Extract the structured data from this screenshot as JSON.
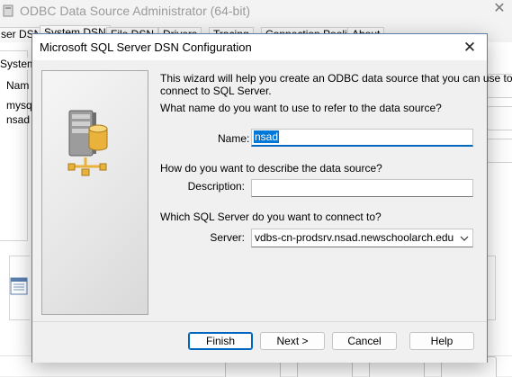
{
  "background_window": {
    "title": "ODBC Data Source Administrator (64-bit)",
    "close_glyph": "✕",
    "tabs": [
      "ser DSN",
      "System DSN",
      "File DSN",
      "Drivers",
      "Tracing",
      "Connection Pooling",
      "About"
    ],
    "group_label": "System",
    "column_header": "Nam",
    "rows": [
      "mysql",
      "nsad"
    ]
  },
  "dialog": {
    "title": "Microsoft SQL Server DSN Configuration",
    "close_glyph": "✕",
    "intro_line1": "This wizard will help you create an ODBC data source that you can use to",
    "intro_line2": "connect to SQL Server.",
    "name_question": "What name do you want to use to refer to the data source?",
    "name_label": "Name:",
    "name_value": "nsad",
    "description_question": "How do you want to describe the data source?",
    "description_label": "Description:",
    "description_value": "",
    "server_question": "Which SQL Server do you want to connect to?",
    "server_label": "Server:",
    "server_value": "vdbs-cn-prodsrv.nsad.newschoolarch.edu",
    "buttons": {
      "finish": "Finish",
      "next": "Next >",
      "cancel": "Cancel",
      "help": "Help"
    }
  },
  "icons": {
    "dialog_close": "close-icon",
    "wizard_graphic": "database-server-icon",
    "server_dropdown": "chevron-down-icon",
    "background_app": "odbc-app-icon",
    "background_info": "data-source-info-icon"
  },
  "colors": {
    "accent": "#0067c0",
    "selection": "#0078d7",
    "dialog_border": "#5a7fa8",
    "server_tower": "#8f8f8f",
    "database_cylinder": "#e9b23a"
  }
}
